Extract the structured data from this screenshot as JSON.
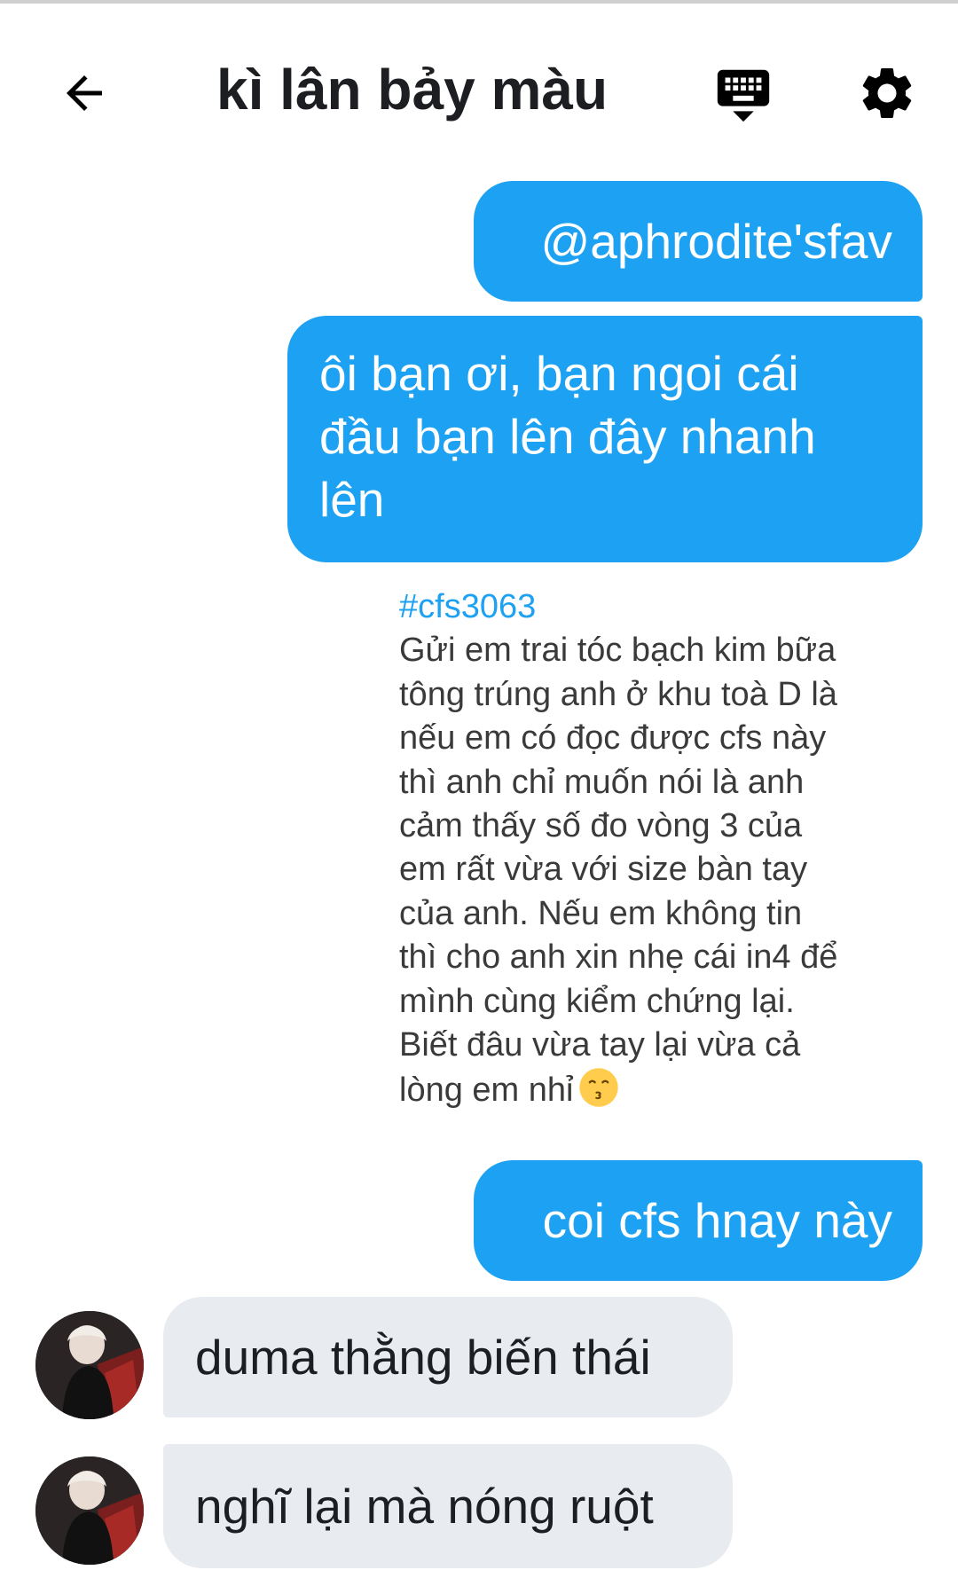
{
  "header": {
    "title": "kì lân bảy màu",
    "back_icon": "arrow-left-icon",
    "keyboard_icon": "keyboard-hide-icon",
    "settings_icon": "gear-icon"
  },
  "messages": {
    "sent_1": "@aphrodite'sfav",
    "sent_2": "ôi bạn ơi, bạn ngoi cái đầu bạn lên đây nhanh lên",
    "shared_post": {
      "tag": "#cfs3063",
      "body": "Gửi em trai tóc bạch kim bữa\ntông trúng anh ở khu toà D là\nnếu em có đọc được cfs này\nthì anh chỉ muốn nói là anh\ncảm thấy số đo vòng 3 của\nem rất vừa với size bàn tay\ncủa anh. Nếu em không tin\nthì cho anh xin nhẹ cái in4 để\nmình cùng kiểm chứng lại.\nBiết đâu vừa tay lại vừa cả\nlòng em nhỉ",
      "emoji": "kissing-face-emoji"
    },
    "sent_3": "coi cfs hnay này",
    "received_1": "duma thằng biến thái",
    "received_2": "nghĩ lại mà nóng ruột"
  },
  "colors": {
    "sent_bubble": "#1da1f2",
    "received_bubble": "#e8ebef",
    "tag": "#1da1f2"
  }
}
